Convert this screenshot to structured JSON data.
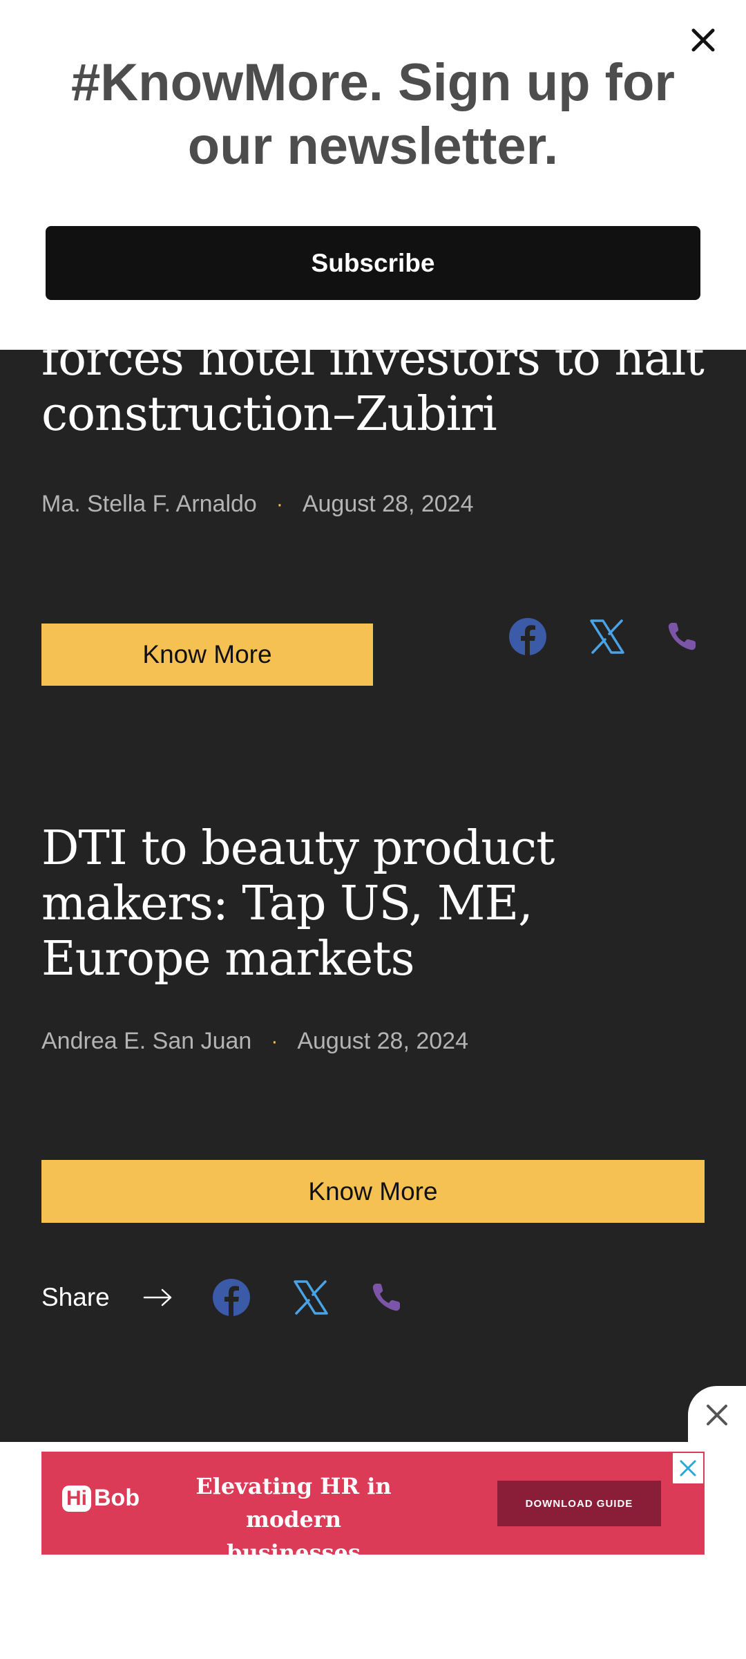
{
  "newsletter": {
    "title": "#KnowMore. Sign up for our newsletter.",
    "subscribe_label": "Subscribe",
    "close_icon": "close-icon"
  },
  "article1": {
    "headline": "forces hotel investors to halt construction–Zubiri",
    "author": "Ma. Stella F. Arnaldo",
    "separator": "·",
    "date": "August 28, 2024",
    "button_label": "Know More"
  },
  "article2": {
    "headline": "DTI to beauty product makers: Tap US, ME, Europe markets",
    "author": "Andrea E. San Juan",
    "separator": "·",
    "date": "August 28, 2024",
    "button_label": "Know More",
    "share_label": "Share"
  },
  "share_icons": [
    "facebook-icon",
    "x-twitter-icon",
    "phone-icon"
  ],
  "colors": {
    "accent": "#f5c153",
    "background": "#232323",
    "facebook": "#3b5aa8",
    "twitter": "#4aa3e6",
    "phone": "#7c55a8",
    "ad": "#db3b57"
  },
  "ad": {
    "logo_hi": "Hi",
    "logo_bob": "Bob",
    "text": "Elevating HR in modern businesses",
    "cta": "DOWNLOAD GUIDE"
  }
}
